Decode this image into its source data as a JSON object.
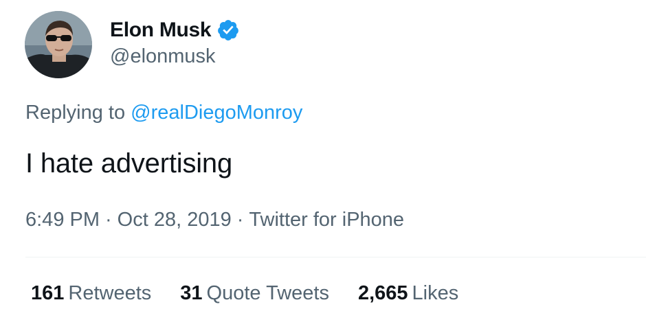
{
  "author": {
    "display_name": "Elon Musk",
    "handle": "@elonmusk",
    "verified": true,
    "avatar_icon": "profile-photo"
  },
  "reply": {
    "prefix": "Replying to ",
    "target": "@realDiegoMonroy"
  },
  "tweet": {
    "text": "I hate advertising"
  },
  "meta": {
    "time": "6:49 PM",
    "separator": "·",
    "date": "Oct 28, 2019",
    "source": "Twitter for iPhone"
  },
  "stats": {
    "retweets": {
      "count": "161",
      "label": "Retweets"
    },
    "quote_tweets": {
      "count": "31",
      "label": "Quote Tweets"
    },
    "likes": {
      "count": "2,665",
      "label": "Likes"
    }
  },
  "colors": {
    "link": "#1d9bf0",
    "secondary_text": "#536471",
    "primary_text": "#0f1419",
    "verified_badge": "#1d9bf0"
  }
}
